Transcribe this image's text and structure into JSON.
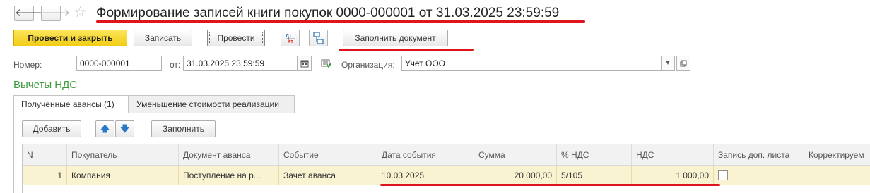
{
  "window": {
    "title": "Формирование записей книги покупок 0000-000001 от 31.03.2025 23:59:59",
    "back_glyph": "🡐",
    "forward_glyph": "🡒",
    "star_glyph": "☆"
  },
  "toolbar": {
    "post_close_label": "Провести и закрыть",
    "save_label": "Записать",
    "post_label": "Провести",
    "dtkt_icon": "dt-kt-icon",
    "structure_icon": "structure-icon",
    "fill_label": "Заполнить документ"
  },
  "header_fields": {
    "number_label": "Номер:",
    "number_value": "0000-000001",
    "date_label": "от:",
    "date_value": "31.03.2025 23:59:59",
    "org_label": "Организация:",
    "org_value": "Учет ООО"
  },
  "section_title": "Вычеты НДС",
  "tabs": [
    {
      "label": "Полученные авансы (1)"
    },
    {
      "label": "Уменьшение стоимости реализации"
    }
  ],
  "grid_toolbar": {
    "add_label": "Добавить",
    "up_glyph": "🡅",
    "down_glyph": "🡇",
    "fill_label": "Заполнить"
  },
  "table": {
    "columns": [
      "N",
      "Покупатель",
      "Документ аванса",
      "Событие",
      "Дата события",
      "Сумма",
      "% НДС",
      "НДС",
      "Запись доп. листа",
      "Корректируем"
    ],
    "rows": [
      [
        "1",
        "Компания",
        "Поступление на р...",
        "Зачет аванса",
        "10.03.2025",
        "20 000,00",
        "5/105",
        "1 000,00",
        "",
        ""
      ]
    ]
  },
  "colors": {
    "primary_button": "#f3cc14",
    "section_title": "#3a9a3a",
    "selected_row": "#faf3d1",
    "annotation_underline": "#e0141e"
  }
}
